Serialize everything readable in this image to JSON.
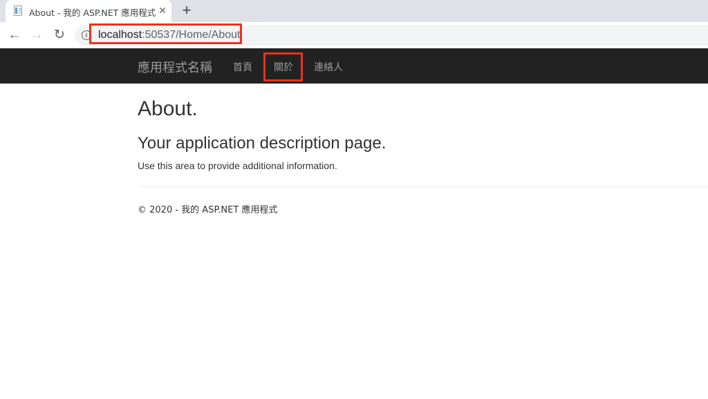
{
  "browser": {
    "tab": {
      "title": "About - 我的 ASP.NET 應用程式",
      "favicon": "page-icon",
      "close_glyph": "✕"
    },
    "new_tab_glyph": "+",
    "nav": {
      "back_glyph": "←",
      "forward_glyph": "→",
      "reload_glyph": "↻"
    },
    "address_bar": {
      "info_glyph": "i",
      "host": "localhost",
      "path": ":50537/Home/About"
    },
    "highlight_color": "#f03018"
  },
  "navbar": {
    "brand": "應用程式名稱",
    "links": [
      {
        "label": "首頁"
      },
      {
        "label": "關於",
        "active": true
      },
      {
        "label": "連絡人"
      }
    ],
    "background": "#222222"
  },
  "content": {
    "title": "About.",
    "subtitle": "Your application description page.",
    "paragraph": "Use this area to provide additional information."
  },
  "footer": {
    "text": "© 2020 - 我的 ASP.NET 應用程式"
  }
}
